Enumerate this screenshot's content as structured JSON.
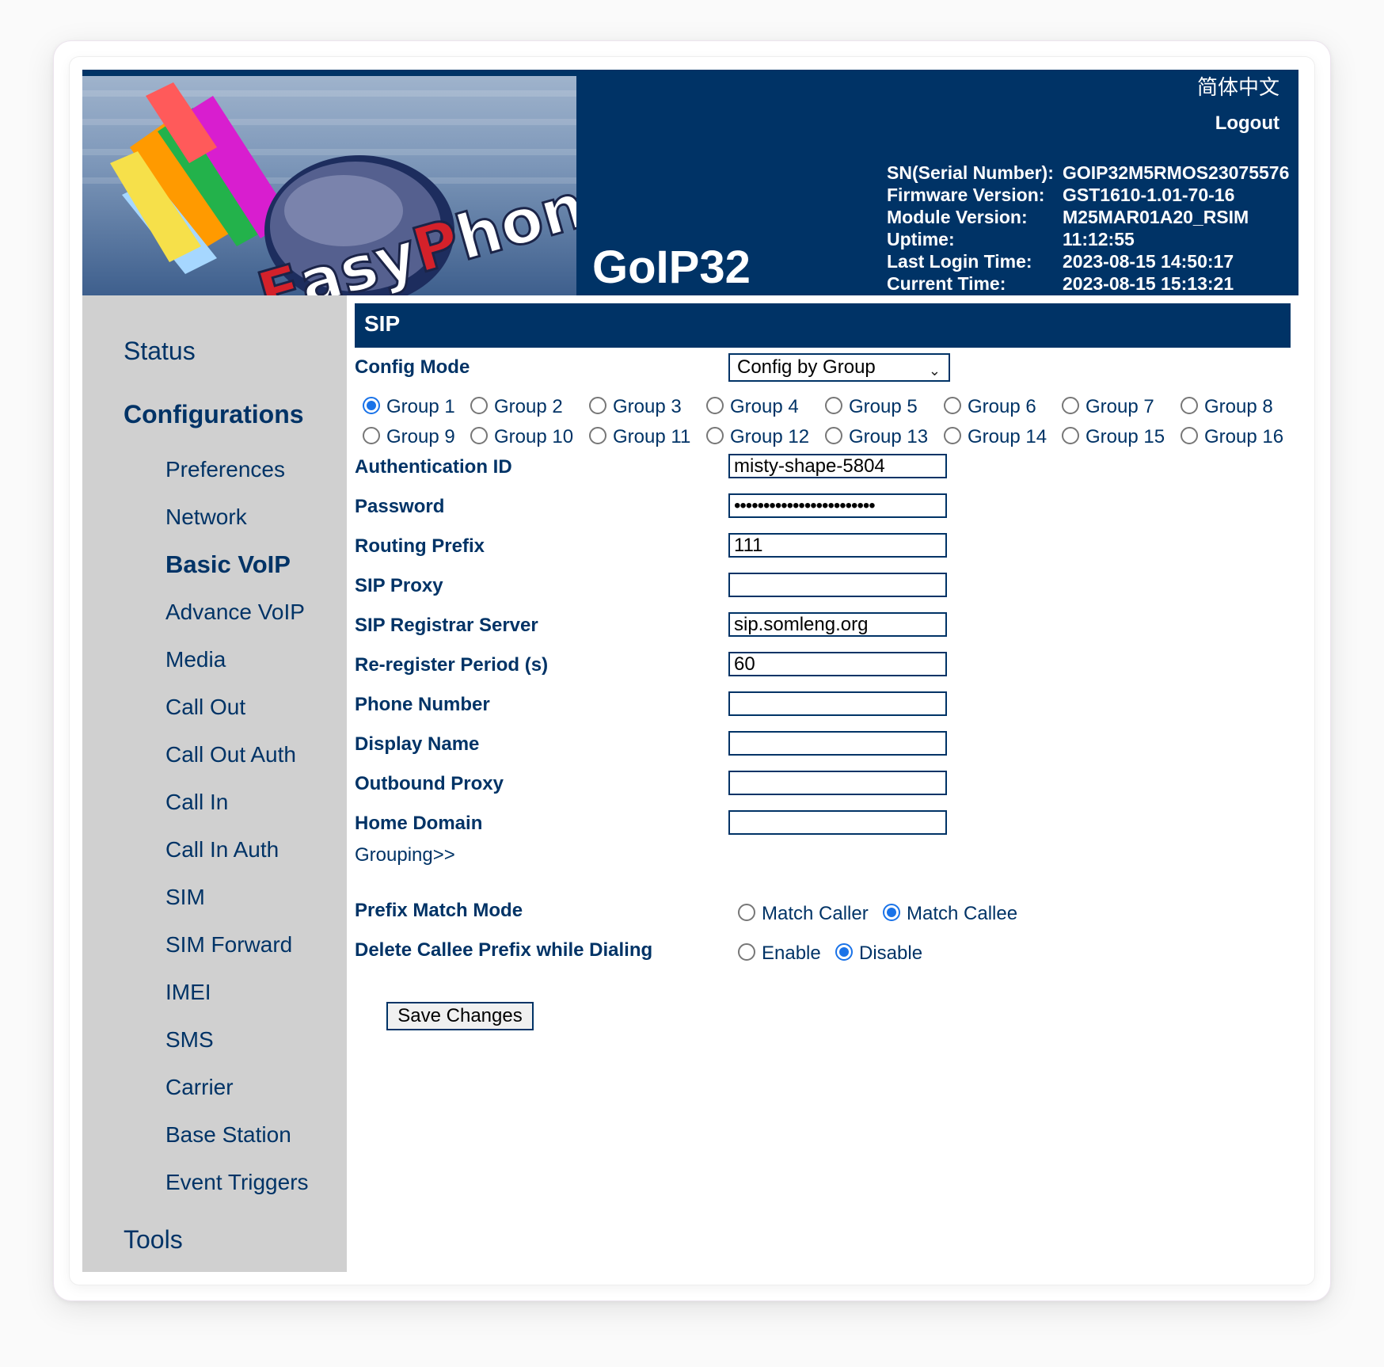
{
  "header": {
    "product_name": "GoIP32",
    "language_link": "简体中文",
    "logout": "Logout",
    "logo_text": "EasyPhone",
    "info": [
      {
        "label": "SN(Serial Number):",
        "value": "GOIP32M5RMOS23075576"
      },
      {
        "label": "Firmware Version:",
        "value": "GST1610-1.01-70-16"
      },
      {
        "label": "Module Version:",
        "value": "M25MAR01A20_RSIM"
      },
      {
        "label": "Uptime:",
        "value": "11:12:55"
      },
      {
        "label": "Last Login Time:",
        "value": "2023-08-15 14:50:17"
      },
      {
        "label": "Current Time:",
        "value": "2023-08-15 15:13:21"
      }
    ]
  },
  "sidebar": {
    "status": "Status",
    "configurations": "Configurations",
    "items": [
      "Preferences",
      "Network",
      "Basic VoIP",
      "Advance VoIP",
      "Media",
      "Call Out",
      "Call Out Auth",
      "Call In",
      "Call In Auth",
      "SIM",
      "SIM Forward",
      "IMEI",
      "SMS",
      "Carrier",
      "Base Station",
      "Event Triggers"
    ],
    "active_item": "Basic VoIP",
    "tools": "Tools"
  },
  "form": {
    "section_title": "SIP",
    "config_mode": {
      "label": "Config Mode",
      "value": "Config by Group"
    },
    "groups": [
      "Group 1",
      "Group 2",
      "Group 3",
      "Group 4",
      "Group 5",
      "Group 6",
      "Group 7",
      "Group 8",
      "Group 9",
      "Group 10",
      "Group 11",
      "Group 12",
      "Group 13",
      "Group 14",
      "Group 15",
      "Group 16"
    ],
    "selected_group": "Group 1",
    "fields": [
      {
        "label": "Authentication ID",
        "value": "misty-shape-5804"
      },
      {
        "label": "Password",
        "value": "••••••••••••••••••••••••"
      },
      {
        "label": "Routing Prefix",
        "value": "111"
      },
      {
        "label": "SIP Proxy",
        "value": ""
      },
      {
        "label": "SIP Registrar Server",
        "value": "sip.somleng.org"
      },
      {
        "label": "Re-register Period (s)",
        "value": "60"
      },
      {
        "label": "Phone Number",
        "value": ""
      },
      {
        "label": "Display Name",
        "value": ""
      },
      {
        "label": "Outbound Proxy",
        "value": ""
      },
      {
        "label": "Home Domain",
        "value": ""
      }
    ],
    "grouping_link": "Grouping>>",
    "prefix_match_mode": {
      "label": "Prefix Match Mode",
      "options": [
        "Match Caller",
        "Match Callee"
      ],
      "selected": "Match Callee"
    },
    "delete_callee_prefix": {
      "label": "Delete Callee Prefix while Dialing",
      "options": [
        "Enable",
        "Disable"
      ],
      "selected": "Disable"
    },
    "save_button": "Save Changes"
  },
  "colors": {
    "navy": "#003366",
    "sidebar_bg": "#d0d0d0",
    "radio_checked": "#1a73e8"
  }
}
